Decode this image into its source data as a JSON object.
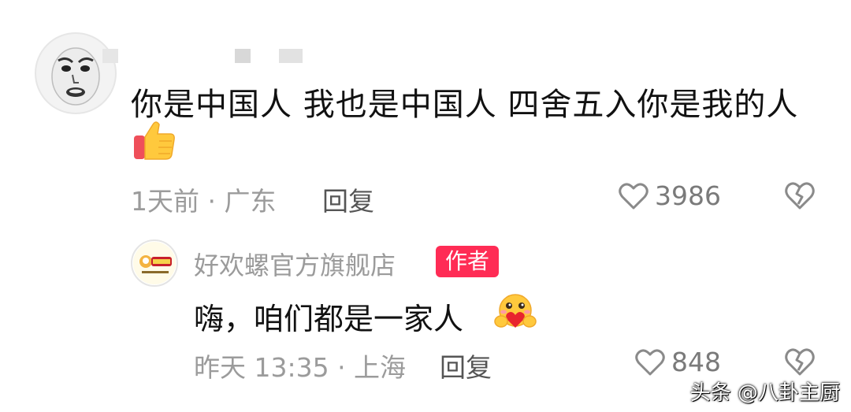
{
  "comment": {
    "text": "你是中国人 我也是中国人 四舍五入你是我的人",
    "meta": "1天前 · 广东",
    "reply_label": "回复",
    "likes": "3986"
  },
  "reply": {
    "username": "好欢螺官方旗舰店",
    "badge": "作者",
    "text": "嗨，咱们都是一家人",
    "meta": "昨天 13:35 · 上海",
    "reply_label": "回复",
    "likes": "848"
  },
  "watermark": "头条 @八卦主厨",
  "colors": {
    "badge_bg": "#ff2c55",
    "text_primary": "#111111",
    "text_secondary": "#9b9b9b"
  },
  "icons": [
    "thumbs-up-emoji",
    "heart-outline-icon",
    "broken-heart-icon",
    "hug-emoji"
  ]
}
